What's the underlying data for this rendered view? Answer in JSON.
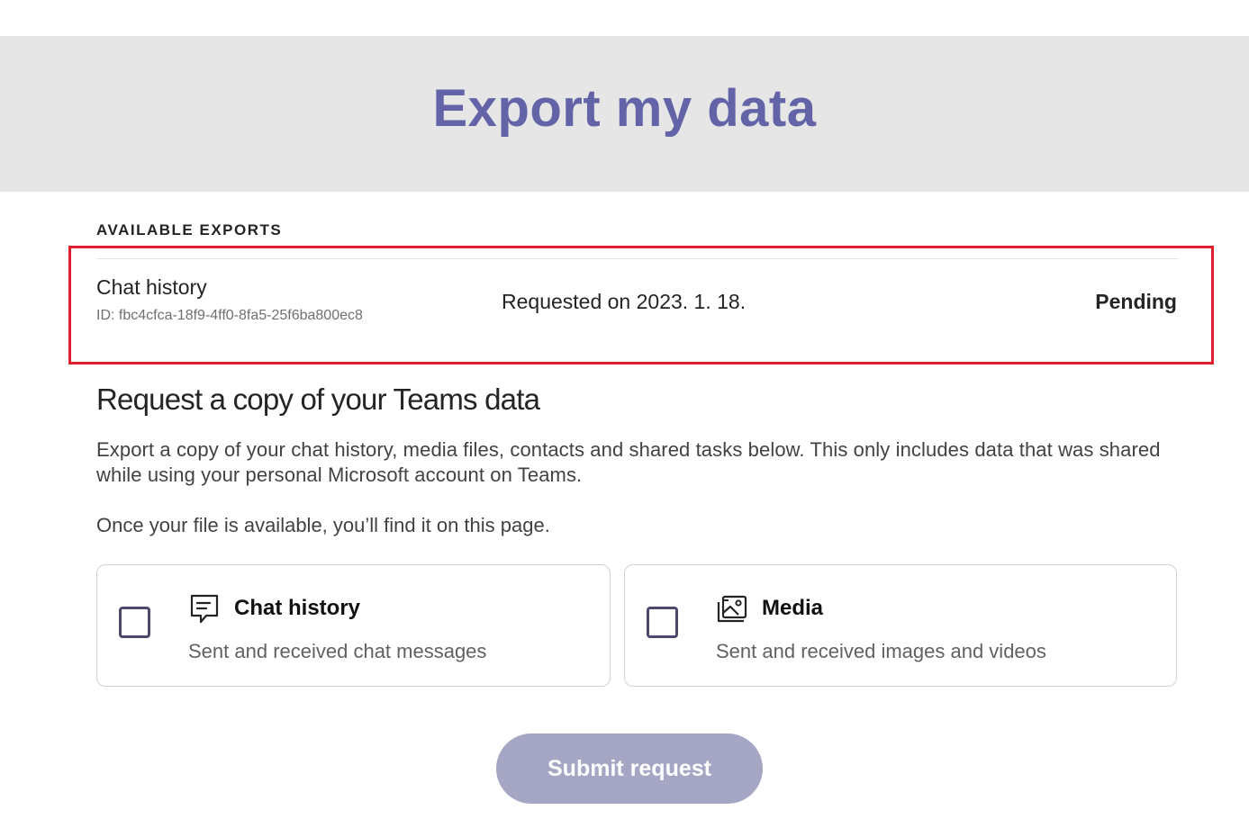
{
  "page": {
    "title": "Export my data"
  },
  "available_exports": {
    "label": "AVAILABLE EXPORTS",
    "items": [
      {
        "name": "Chat history",
        "id": "ID: fbc4cfca-18f9-4ff0-8fa5-25f6ba800ec8",
        "requested": "Requested on 2023. 1. 18.",
        "status": "Pending"
      }
    ]
  },
  "request": {
    "heading": "Request a copy of your Teams data",
    "description": "Export a copy of your chat history, media files, contacts and shared tasks below. This only includes data that was shared while using your personal Microsoft account on Teams.",
    "note": "Once your file is available, you’ll find it on this page.",
    "options": [
      {
        "title": "Chat history",
        "description": "Sent and received chat messages",
        "icon": "chat-icon",
        "checked": false
      },
      {
        "title": "Media",
        "description": "Sent and received images and videos",
        "icon": "media-icon",
        "checked": false
      }
    ],
    "submit_label": "Submit request"
  },
  "colors": {
    "accent": "#6264a7",
    "highlight_border": "#e0202e",
    "banner_bg": "#e6e6e6",
    "button_disabled": "#a4a6c4"
  }
}
